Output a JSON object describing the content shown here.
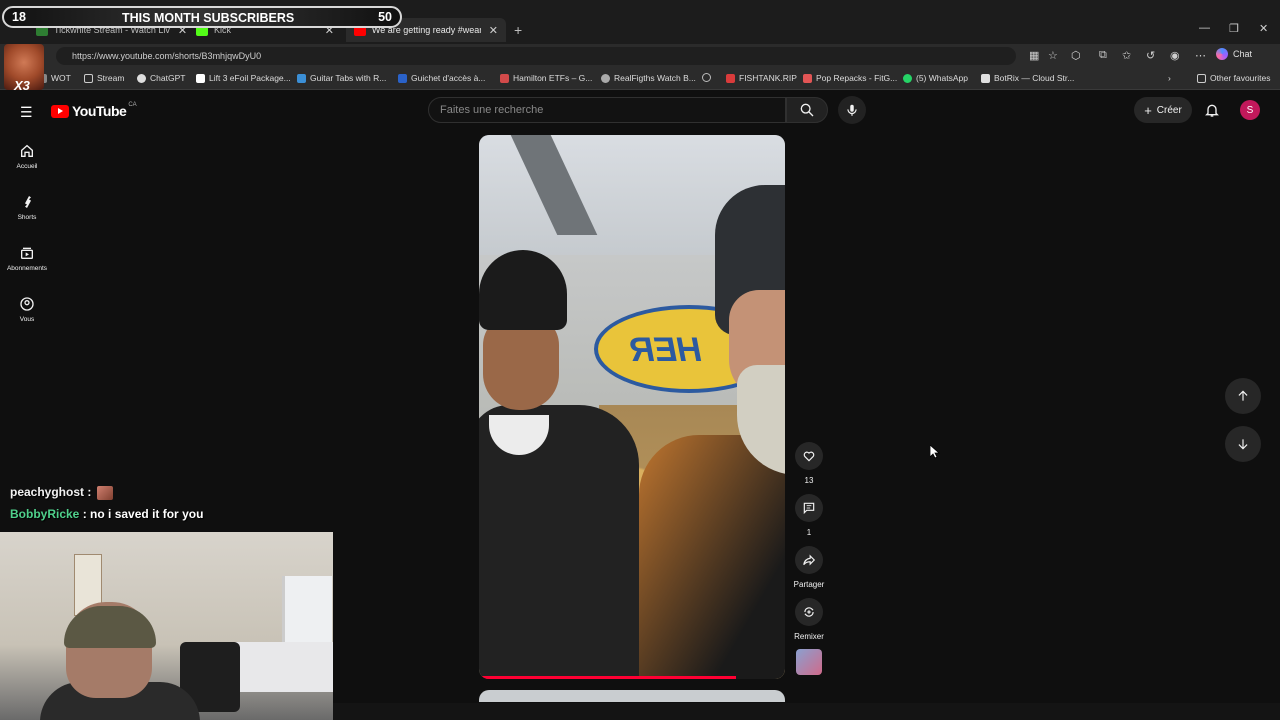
{
  "overlay": {
    "subscribers_left": "18",
    "subscribers_title": "THIS MONTH SUBSCRIBERS",
    "subscribers_right": "50"
  },
  "browser": {
    "tabs": [
      {
        "label": "Tickwhite Stream - Watch Liv",
        "icon_color": "#2e7d32"
      },
      {
        "label": "Kick",
        "icon_color": "#53fc18"
      },
      {
        "label": "We are getting ready #weare",
        "icon_color": "#ff0000"
      }
    ],
    "new_tab": "+",
    "url": "https://www.youtube.com/shorts/B3mhjqwDyU0",
    "chat_label": "Chat",
    "bookmarks": [
      {
        "label": "WOT",
        "icon_color": "#888888"
      },
      {
        "label": "Stream",
        "icon_color": "#cccccc"
      },
      {
        "label": "ChatGPT",
        "icon_color": "#dddddd"
      },
      {
        "label": "Lift 3 eFoil Package...",
        "icon_color": "#ffffff"
      },
      {
        "label": "Guitar Tabs with R...",
        "icon_color": "#3b8fd6"
      },
      {
        "label": "Guichet d'accès à...",
        "icon_color": "#2a62c9"
      },
      {
        "label": "Hamilton ETFs – G...",
        "icon_color": "#d24a4a"
      },
      {
        "label": "RealFigths Watch B...",
        "icon_color": "#aaaaaa"
      },
      {
        "label": "",
        "icon_color": "#bbbbbb"
      },
      {
        "label": "FISHTANK.RIP",
        "icon_color": "#d93b3b"
      },
      {
        "label": "Pop Repacks - FitG...",
        "icon_color": "#e25555"
      },
      {
        "label": "(5) WhatsApp",
        "icon_color": "#25d366"
      },
      {
        "label": "BotRix — Cloud Str...",
        "icon_color": "#e0e0e0"
      }
    ],
    "other_favourites": "Other favourites"
  },
  "youtube": {
    "logo_text": "YouTube",
    "country_code": "CA",
    "search_placeholder": "Faites une recherche",
    "create_label": "Créer",
    "account_initial": "S",
    "sidebar": [
      {
        "label": "Accueil",
        "icon": "home-icon"
      },
      {
        "label": "Shorts",
        "icon": "shorts-icon"
      },
      {
        "label": "Abonnements",
        "icon": "subscriptions-icon"
      },
      {
        "label": "Vous",
        "icon": "you-icon"
      }
    ],
    "actions": {
      "like_count": "13",
      "comment_count": "1",
      "share_label": "Partager",
      "remix_label": "Remixer"
    },
    "progress_fraction": 0.84,
    "accent": "#ff0033"
  },
  "chat": [
    {
      "user": "peachyghost",
      "message": ""
    },
    {
      "user": "BobbyRicke",
      "message": "no i saved it for you"
    }
  ]
}
